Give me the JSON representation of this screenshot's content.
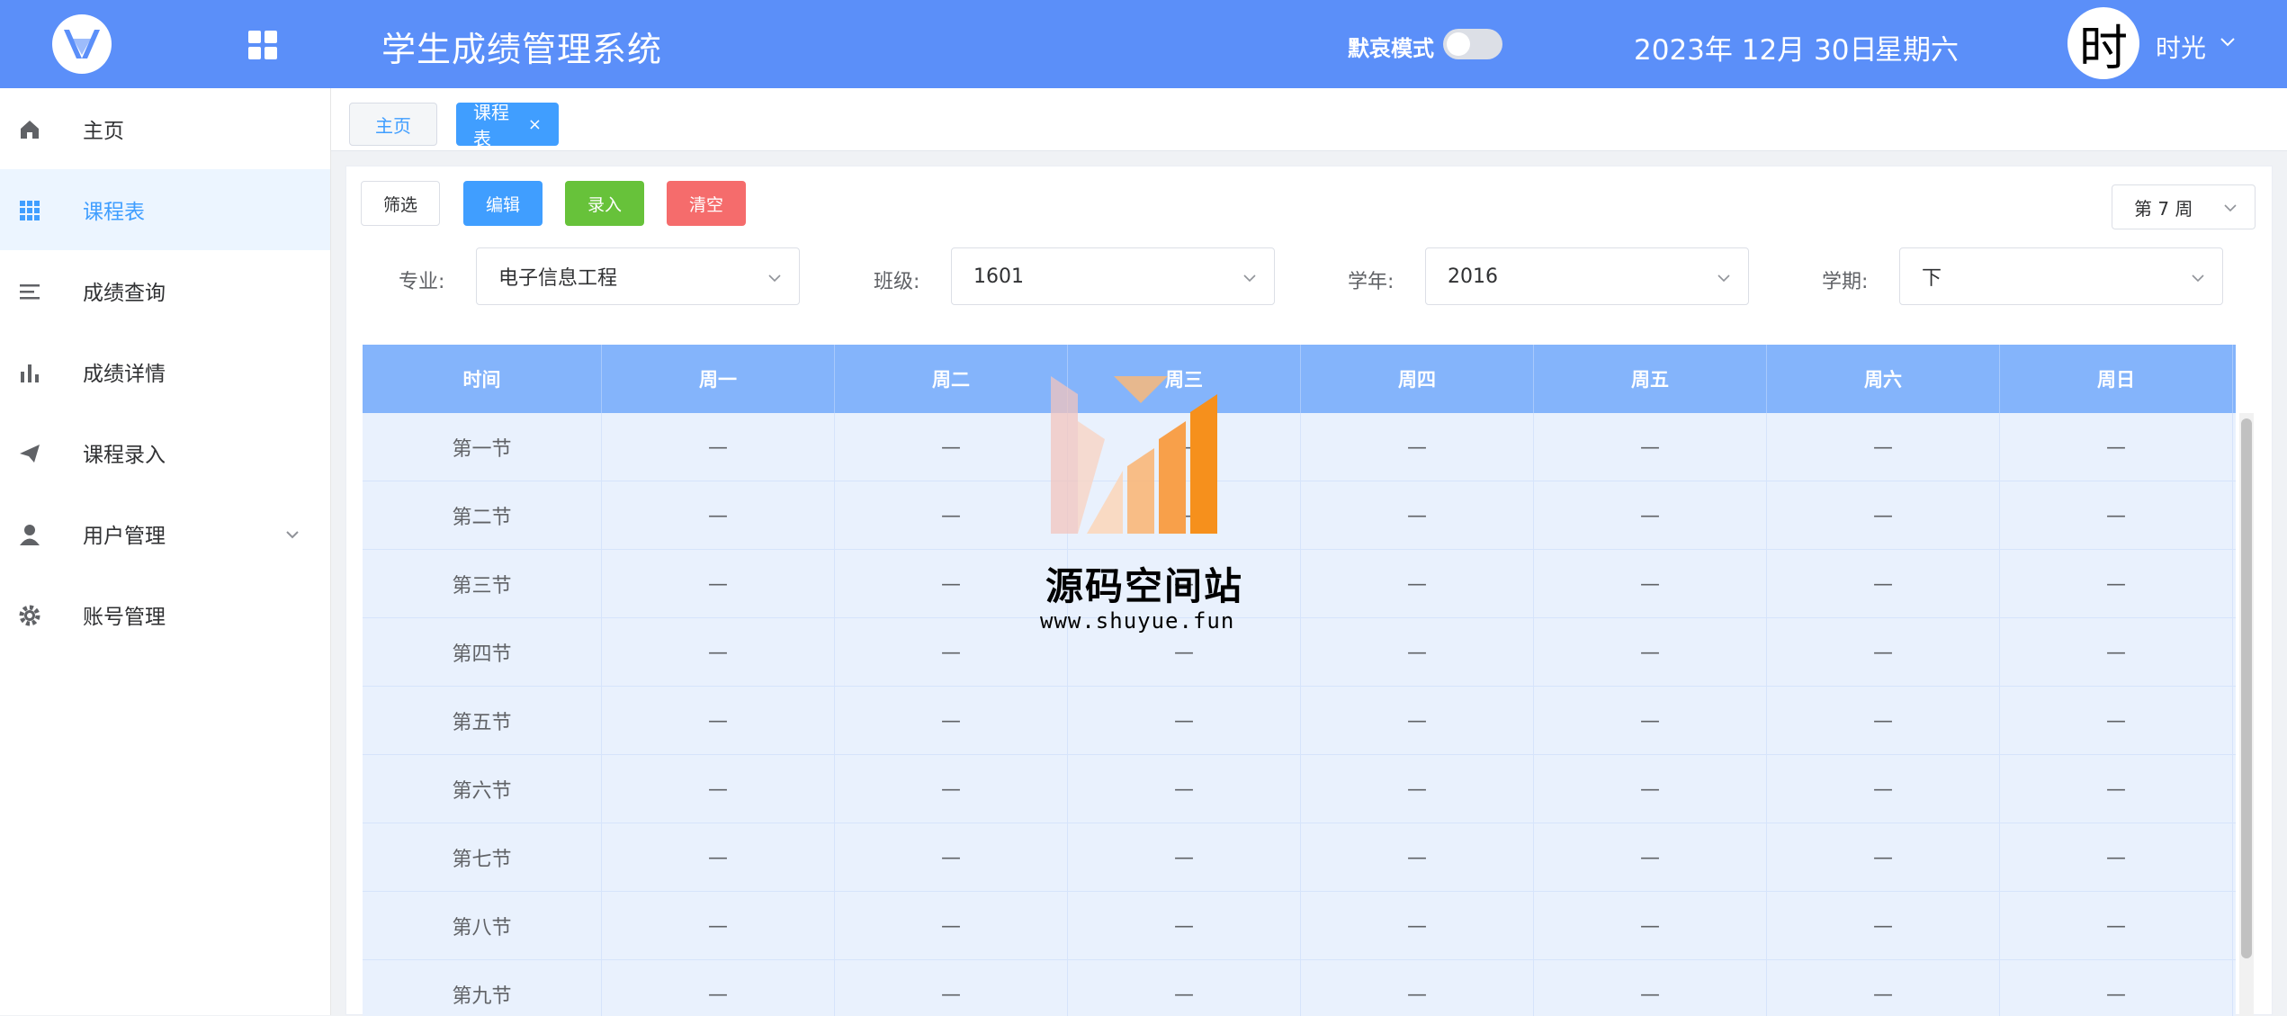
{
  "header": {
    "app_title": "学生成绩管理系统",
    "dark_mode_label": "默哀模式",
    "dark_mode_on": false,
    "date": "2023年 12月 30日",
    "weekday": "星期六",
    "avatar_char": "时",
    "username": "时光"
  },
  "sidebar": {
    "items": [
      {
        "label": "主页",
        "icon": "home-icon"
      },
      {
        "label": "课程表",
        "icon": "grid-icon",
        "active": true
      },
      {
        "label": "成绩查询",
        "icon": "list-icon"
      },
      {
        "label": "成绩详情",
        "icon": "bar-chart-icon"
      },
      {
        "label": "课程录入",
        "icon": "send-icon"
      },
      {
        "label": "用户管理",
        "icon": "user-icon",
        "expandable": true
      },
      {
        "label": "账号管理",
        "icon": "gear-icon"
      }
    ]
  },
  "tabs": {
    "home": "主页",
    "active": "课程表",
    "close_glyph": "×"
  },
  "toolbar": {
    "filter": "筛选",
    "edit": "编辑",
    "entry": "录入",
    "clear": "清空",
    "week": "第 7 周"
  },
  "filters": {
    "major_label": "专业:",
    "major_value": "电子信息工程",
    "class_label": "班级:",
    "class_value": "1601",
    "year_label": "学年:",
    "year_value": "2016",
    "term_label": "学期:",
    "term_value": "下"
  },
  "table": {
    "headers": [
      "时间",
      "周一",
      "周二",
      "周三",
      "周四",
      "周五",
      "周六",
      "周日"
    ],
    "rows": [
      [
        "第一节",
        "—",
        "—",
        "—",
        "—",
        "—",
        "—",
        "—"
      ],
      [
        "第二节",
        "—",
        "—",
        "—",
        "—",
        "—",
        "—",
        "—"
      ],
      [
        "第三节",
        "—",
        "—",
        "—",
        "—",
        "—",
        "—",
        "—"
      ],
      [
        "第四节",
        "—",
        "—",
        "—",
        "—",
        "—",
        "—",
        "—"
      ],
      [
        "第五节",
        "—",
        "—",
        "—",
        "—",
        "—",
        "—",
        "—"
      ],
      [
        "第六节",
        "—",
        "—",
        "—",
        "—",
        "—",
        "—",
        "—"
      ],
      [
        "第七节",
        "—",
        "—",
        "—",
        "—",
        "—",
        "—",
        "—"
      ],
      [
        "第八节",
        "—",
        "—",
        "—",
        "—",
        "—",
        "—",
        "—"
      ],
      [
        "第九节",
        "—",
        "—",
        "—",
        "—",
        "—",
        "—",
        "—"
      ]
    ]
  },
  "watermark": {
    "title": "源码空间站",
    "url": "www.shuyue.fun"
  },
  "colors": {
    "header_bg": "#5b8ff9",
    "accent": "#409eff",
    "success": "#67c23a",
    "danger": "#f56c6c",
    "table_header": "#84b4fb",
    "table_row": "#e9f1fd"
  }
}
